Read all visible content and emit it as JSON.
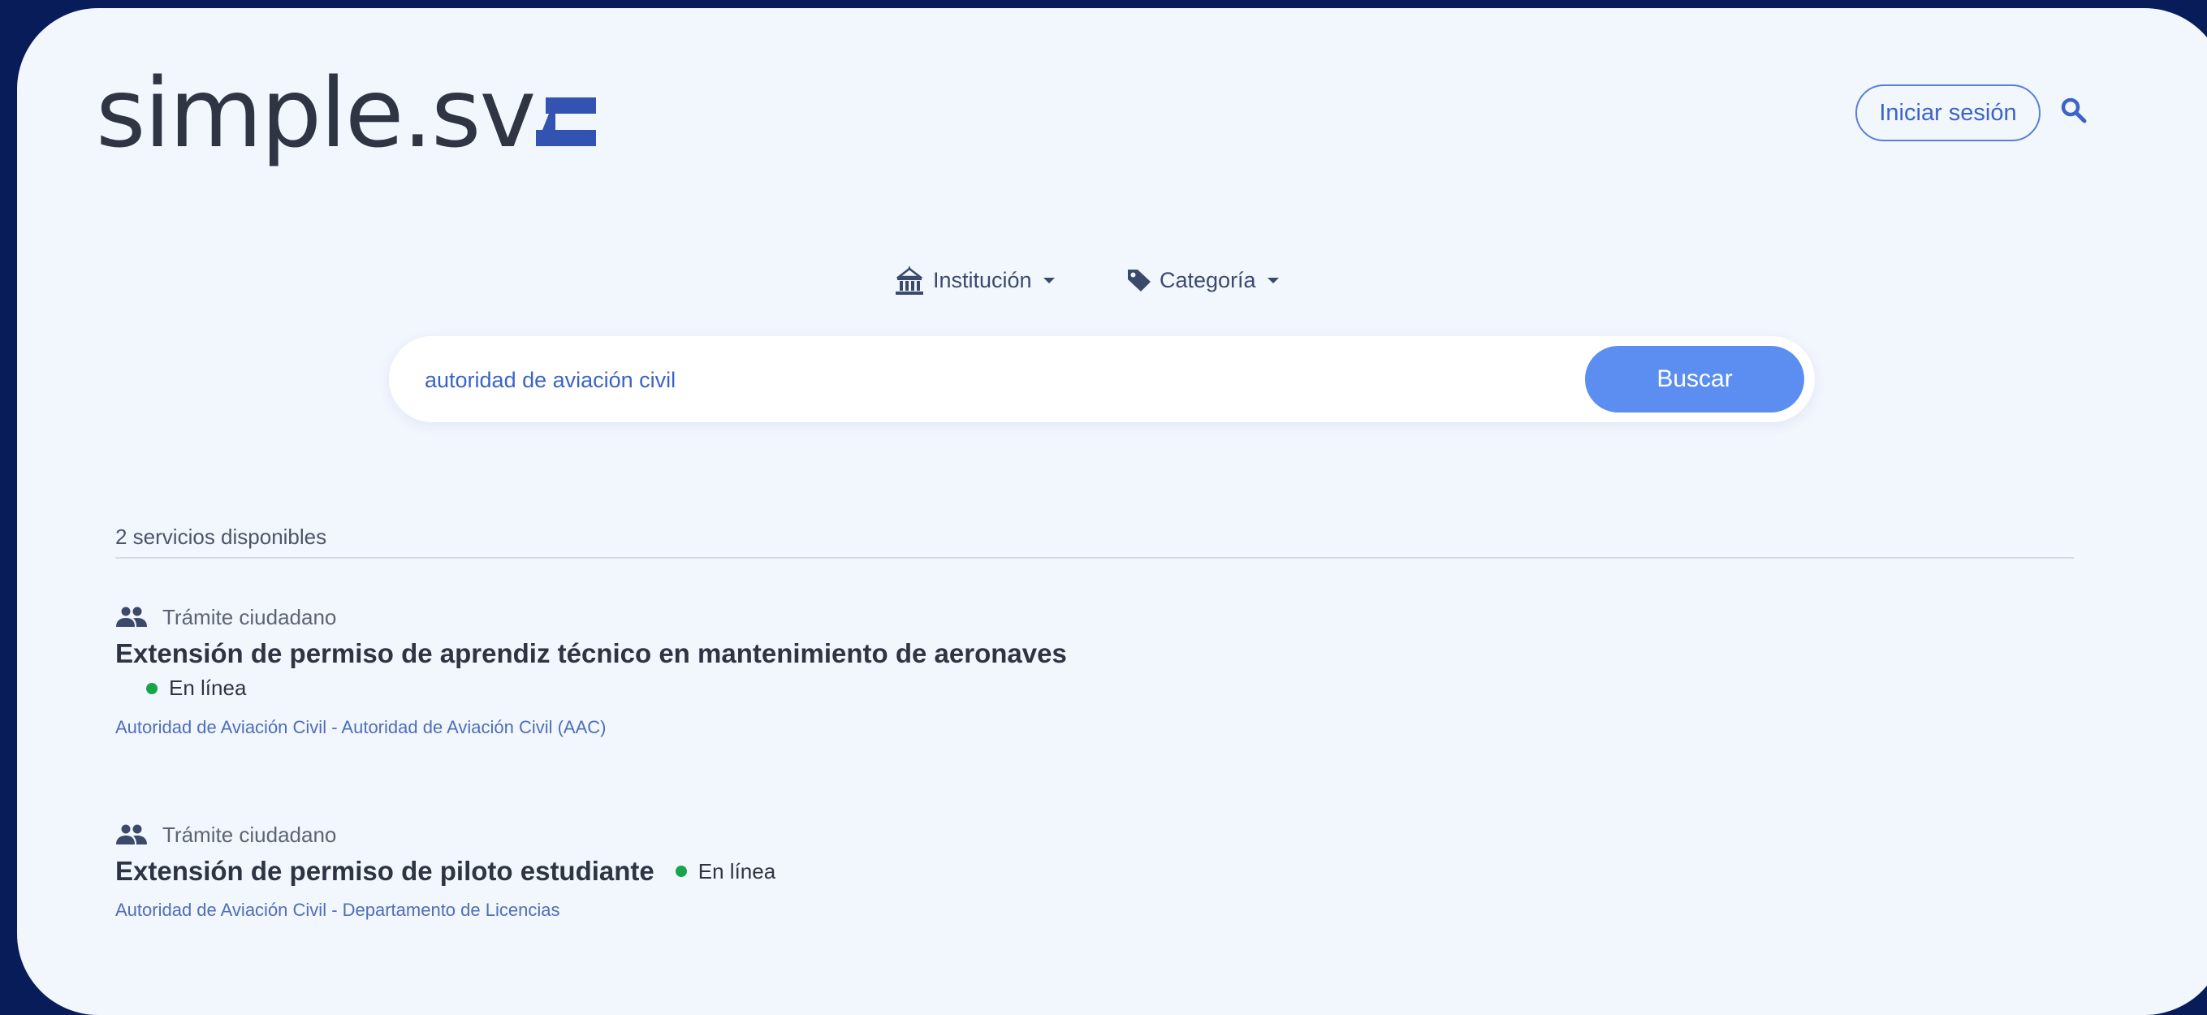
{
  "brand": {
    "logo_text": "simple.sv"
  },
  "header": {
    "login_label": "Iniciar sesión",
    "search_icon": "search-icon"
  },
  "filters": [
    {
      "label": "Institución",
      "icon": "building-icon"
    },
    {
      "label": "Categoría",
      "icon": "tag-icon"
    }
  ],
  "search": {
    "value": "autoridad de aviación civil",
    "button_label": "Buscar"
  },
  "results": {
    "count_text": "2 servicios disponibles",
    "items": [
      {
        "type": "Trámite ciudadano",
        "title": "Extensión de permiso de aprendiz técnico en mantenimiento de aeronaves",
        "status": "En línea",
        "institution": "Autoridad de Aviación Civil - Autoridad de Aviación Civil (AAC)"
      },
      {
        "type": "Trámite ciudadano",
        "title": "Extensión de permiso de piloto estudiante",
        "status": "En línea",
        "institution": "Autoridad de Aviación Civil - Departamento de Licencias"
      }
    ]
  },
  "colors": {
    "background_outer": "#081c5a",
    "page": "#f2f6fd",
    "accent": "#5b8ef0",
    "flag_blue": "#3253b1",
    "status_online": "#18a54a"
  }
}
